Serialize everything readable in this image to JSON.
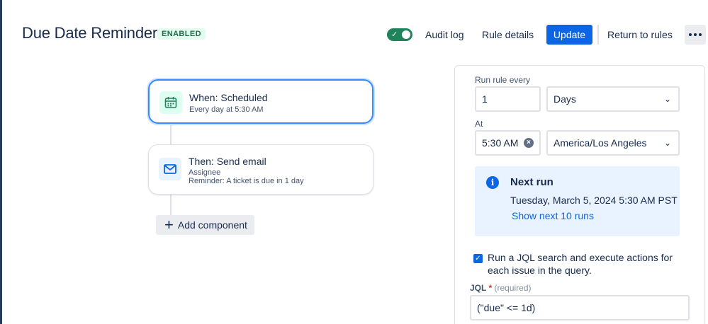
{
  "header": {
    "title": "Due Date Reminder",
    "status": "ENABLED",
    "toggle_enabled": true,
    "audit_log": "Audit log",
    "rule_details": "Rule details",
    "update": "Update",
    "return_to_rules": "Return to rules"
  },
  "flow": {
    "trigger": {
      "icon": "calendar-icon",
      "title": "When: Scheduled",
      "subtitle": "Every day at 5:30 AM"
    },
    "action": {
      "icon": "mail-icon",
      "title": "Then: Send email",
      "line1": "Assignee",
      "line2": "Reminder: A ticket is due in 1 day"
    },
    "add_component": "Add component"
  },
  "panel": {
    "run_every_label": "Run rule every",
    "interval_value": "1",
    "interval_unit": "Days",
    "at_label": "At",
    "time_value": "5:30 AM",
    "timezone": "America/Los Angeles",
    "next_run": {
      "title": "Next run",
      "datetime": "Tuesday, March 5, 2024 5:30 AM PST",
      "link": "Show next 10 runs"
    },
    "jql_checkbox_checked": true,
    "jql_checkbox_label": "Run a JQL search and execute actions for each issue in the query.",
    "jql_label": "JQL",
    "jql_required_mark": "*",
    "jql_hint": "(required)",
    "jql_value": "(\"due\" <= 1d)"
  },
  "colors": {
    "primary": "#0c66e4",
    "success": "#1f845a",
    "info_bg": "#e9f2ff"
  }
}
